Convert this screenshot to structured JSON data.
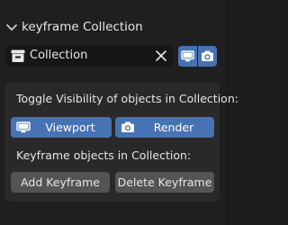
{
  "panel": {
    "title": "keyframe Collection",
    "collection_field": {
      "value": "Collection"
    }
  },
  "visibility": {
    "label": "Toggle Visibility of objects in Collection:",
    "viewport_label": "Viewport",
    "render_label": "Render"
  },
  "keyframe": {
    "label": "Keyframe objects in Collection:",
    "add_label": "Add Keyframe",
    "delete_label": "Delete Keyframe"
  },
  "colors": {
    "accent": "#4772b3",
    "panel_bg": "#1f1f1f",
    "box_bg": "#292929",
    "button_gray": "#545454"
  },
  "icons": {
    "header": "chevron-down-icon",
    "collection": "collection-icon",
    "clear": "close-icon",
    "viewport": "monitor-icon",
    "render": "camera-icon"
  }
}
